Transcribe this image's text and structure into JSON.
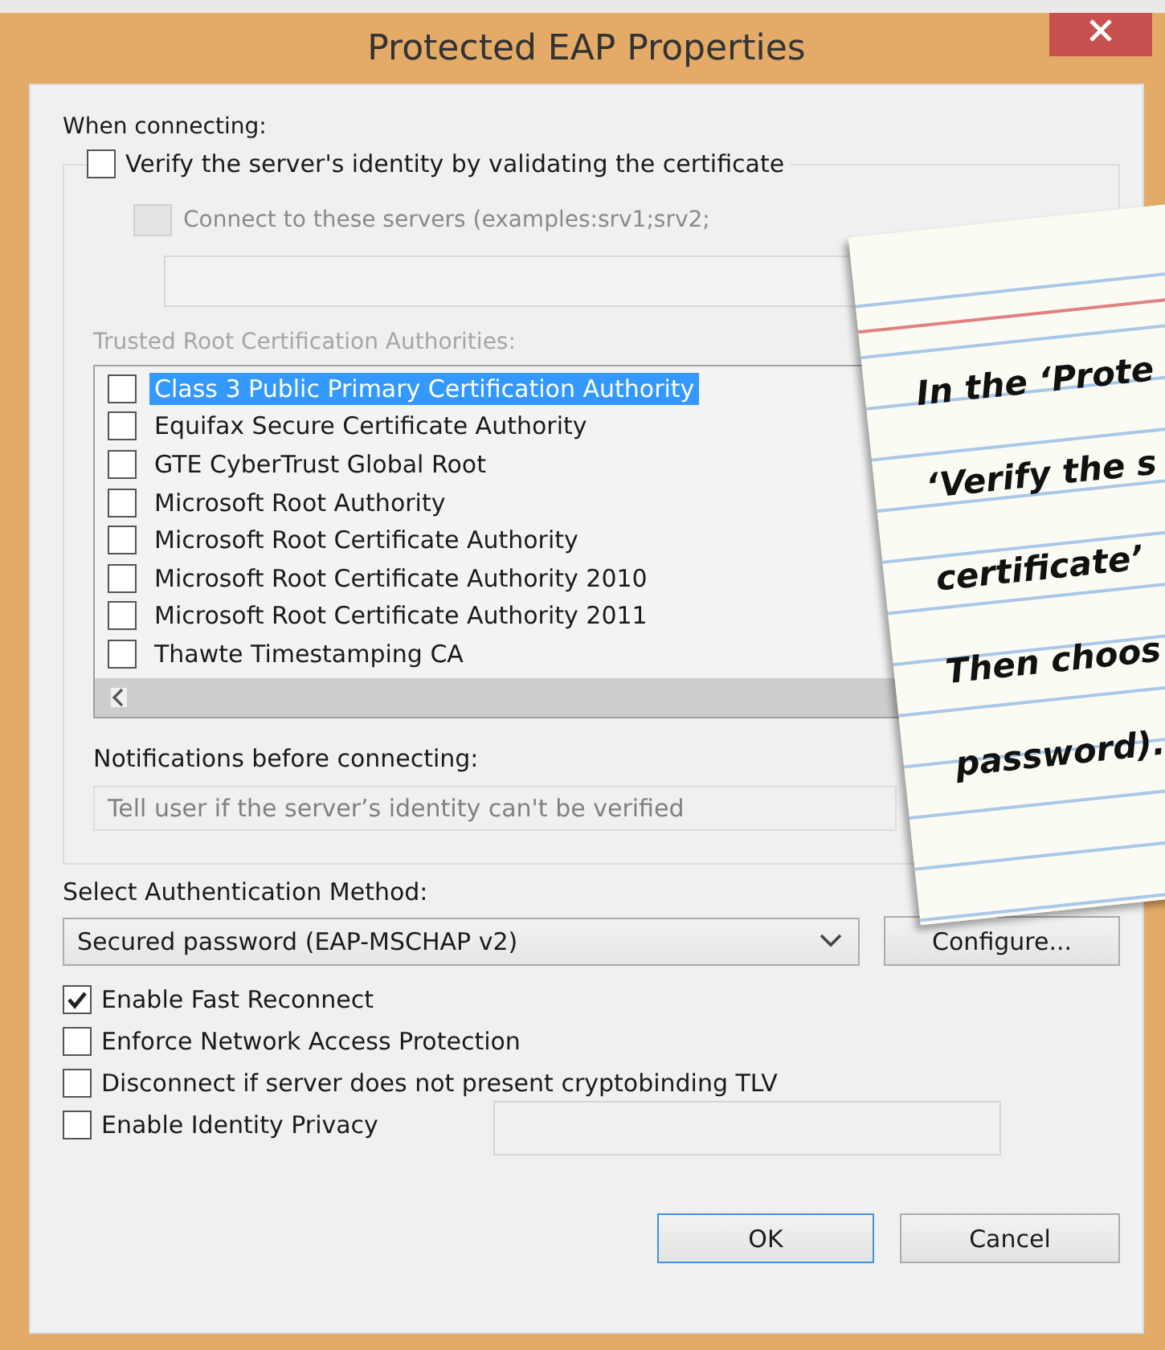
{
  "window": {
    "title": "Protected EAP Properties"
  },
  "when_connecting_label": "When connecting:",
  "verify_checkbox": {
    "label": "Verify the server's identity by validating the certificate",
    "checked": false
  },
  "connect_servers": {
    "label": "Connect to these servers (examples:srv1;srv2;",
    "checked": false,
    "disabled": true
  },
  "trusted_label": "Trusted Root Certification Authorities:",
  "certificates": [
    {
      "name": "Class 3 Public Primary Certification Authority",
      "checked": false,
      "selected": true
    },
    {
      "name": "Equifax Secure Certificate Authority",
      "checked": false,
      "selected": false
    },
    {
      "name": "GTE CyberTrust Global Root",
      "checked": false,
      "selected": false
    },
    {
      "name": "Microsoft Root Authority",
      "checked": false,
      "selected": false
    },
    {
      "name": "Microsoft Root Certificate Authority",
      "checked": false,
      "selected": false
    },
    {
      "name": "Microsoft Root Certificate Authority 2010",
      "checked": false,
      "selected": false
    },
    {
      "name": "Microsoft Root Certificate Authority 2011",
      "checked": false,
      "selected": false
    },
    {
      "name": "Thawte Timestamping CA",
      "checked": false,
      "selected": false
    }
  ],
  "notifications_label": "Notifications before connecting:",
  "notifications_dropdown": {
    "value": "Tell user if the server’s identity can't be verified",
    "disabled": true
  },
  "auth_label": "Select Authentication Method:",
  "auth_method": {
    "value": "Secured password (EAP-MSCHAP v2)"
  },
  "configure_button": "Configure...",
  "options": [
    {
      "label": "Enable Fast Reconnect",
      "checked": true
    },
    {
      "label": "Enforce Network Access Protection",
      "checked": false
    },
    {
      "label": "Disconnect if server does not present cryptobinding TLV",
      "checked": false
    },
    {
      "label": "Enable Identity Privacy",
      "checked": false
    }
  ],
  "ok_button": "OK",
  "cancel_button": "Cancel",
  "note": {
    "lines": [
      "In the ‘Prote",
      "‘Verify the s",
      "certificate’",
      "Then choos",
      "password)."
    ]
  }
}
